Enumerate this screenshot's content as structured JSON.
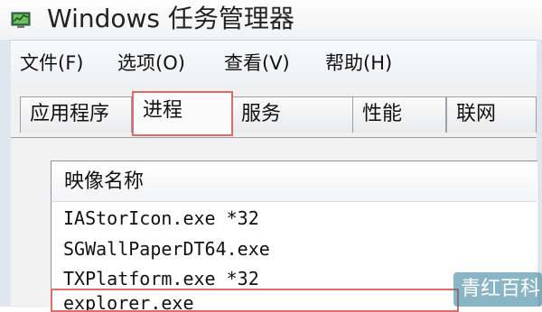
{
  "window": {
    "title": "Windows 任务管理器",
    "icon": "task-manager-icon"
  },
  "menubar": {
    "items": [
      {
        "label": "文件(F)"
      },
      {
        "label": "选项(O)"
      },
      {
        "label": "查看(V)"
      },
      {
        "label": "帮助(H)"
      }
    ]
  },
  "tabs": {
    "items": [
      {
        "label": "应用程序"
      },
      {
        "label": "进程"
      },
      {
        "label": "服务"
      },
      {
        "label": "性能"
      },
      {
        "label": "联网"
      }
    ],
    "active": "进程"
  },
  "process_list": {
    "column_header": "映像名称",
    "rows": [
      "IAStorIcon.exe *32",
      "SGWallPaperDT64.exe",
      "TXPlatform.exe *32",
      "explorer.exe"
    ]
  },
  "watermark": {
    "text": "青红百科"
  },
  "colors": {
    "highlight_outline": "#e06a6a",
    "frame": "#dfe6ee"
  }
}
